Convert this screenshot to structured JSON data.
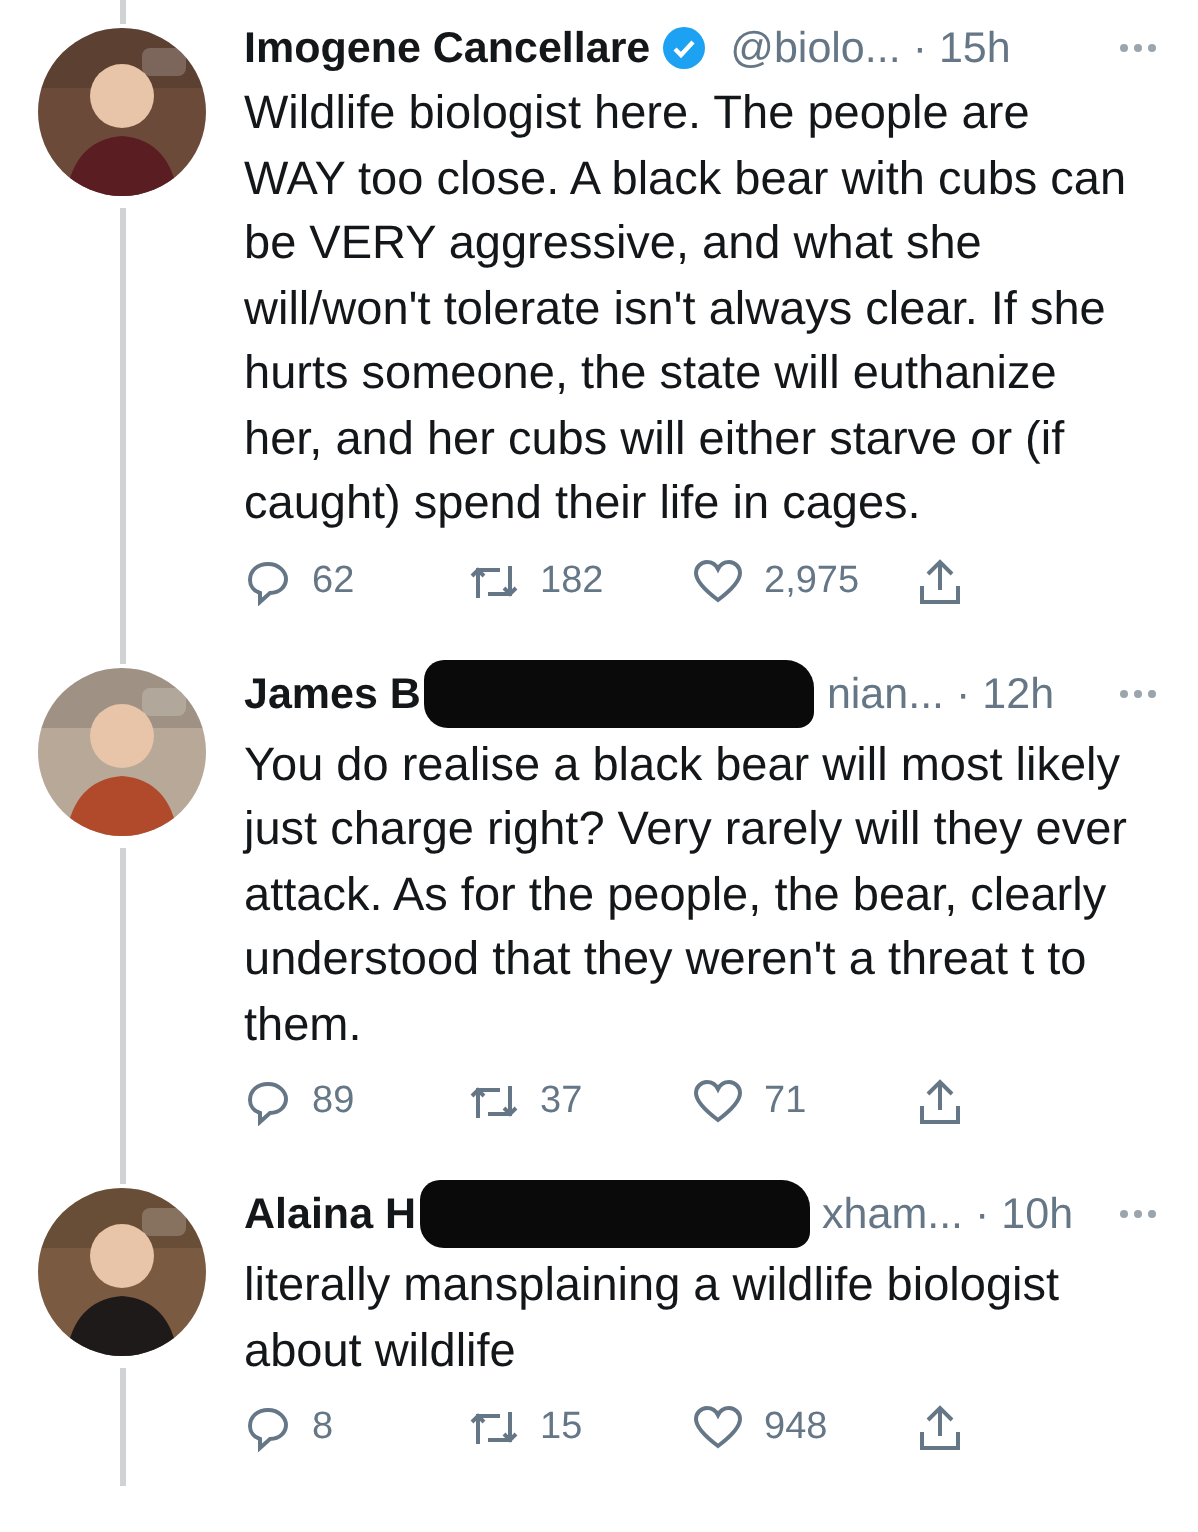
{
  "tweets": [
    {
      "name": "Imogene Cancellare",
      "verified": true,
      "redacted": false,
      "handle": "@biolo...",
      "time": "· 15h",
      "text": "Wildlife biologist here. The people are WAY too close. A black bear with cubs can be VERY aggressive, and what she will/won't tolerate isn't always clear. If she hurts someone, the state will euthanize her, and her cubs will either starve or (if caught) spend their life in cages.",
      "replies": "62",
      "retweets": "182",
      "likes": "2,975"
    },
    {
      "name": "James B",
      "verified": false,
      "redacted": true,
      "handle": "nian...",
      "time": "· 12h",
      "text": "You do realise a black bear will most likely just charge right? Very rarely will they ever attack. As for the people, the bear, clearly understood that they weren't a threat t to them.",
      "replies": "89",
      "retweets": "37",
      "likes": "71"
    },
    {
      "name": "Alaina H",
      "verified": false,
      "redacted": true,
      "handle": "xham...",
      "time": "· 10h",
      "text": "literally mansplaining a wildlife biologist about wildlife",
      "replies": "8",
      "retweets": "15",
      "likes": "948"
    }
  ]
}
